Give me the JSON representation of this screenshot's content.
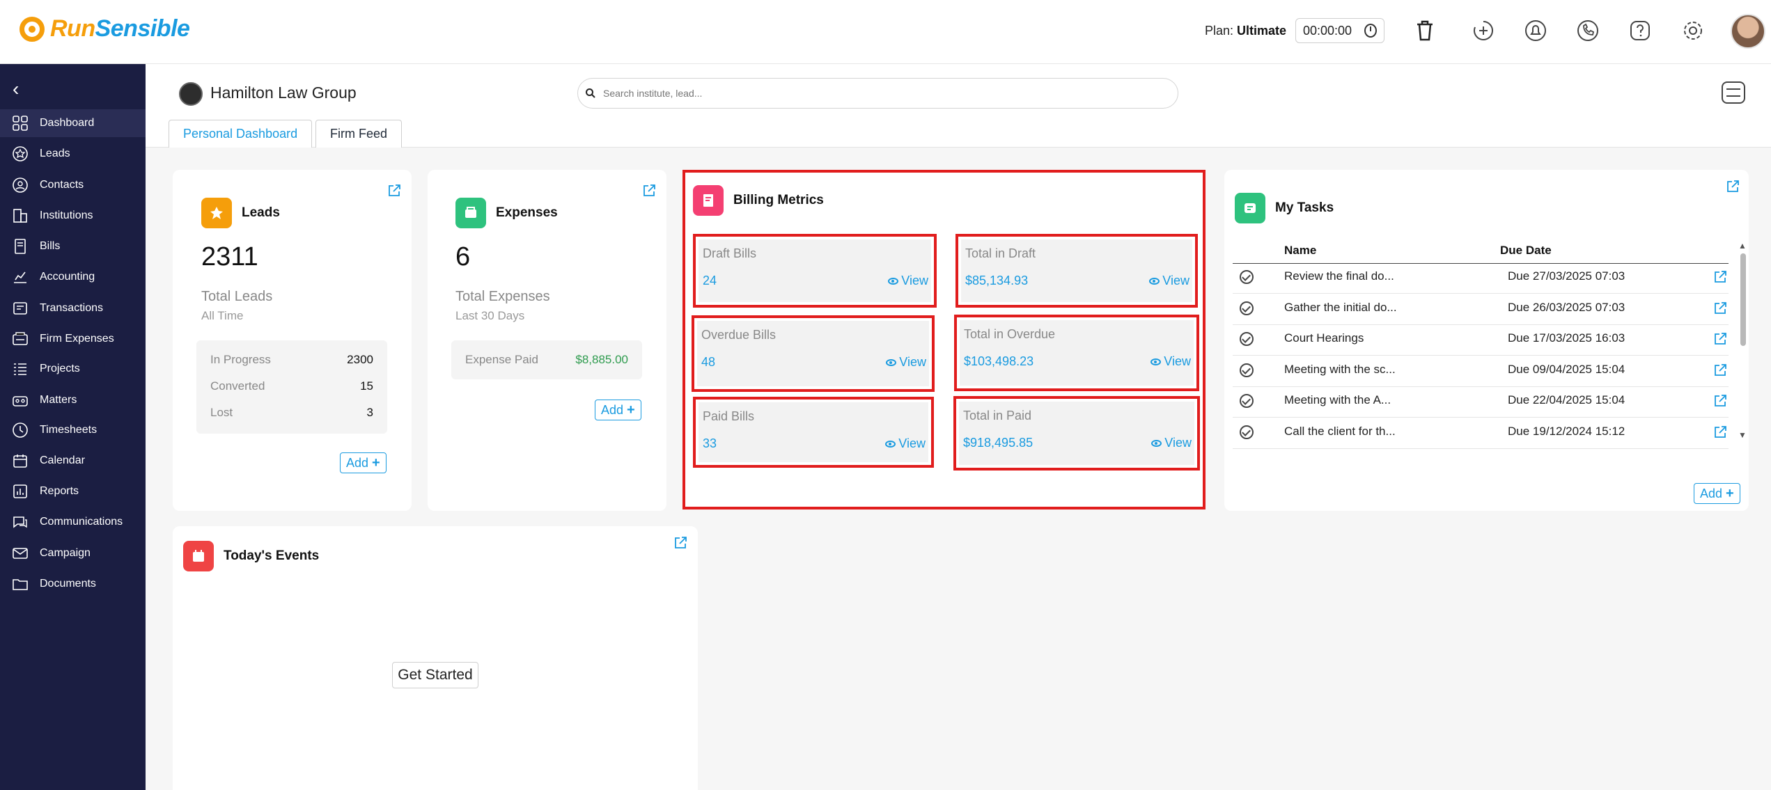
{
  "brand": {
    "name_part1": "Run",
    "name_part2": "Sensible",
    "color_orange": "#f59e0b",
    "color_blue": "#1a9be0"
  },
  "topbar": {
    "plan_label": "Plan:",
    "plan_value": "Ultimate",
    "timer": "00:00:00",
    "icons": [
      "trash-icon",
      "add-activity-icon",
      "bell-icon",
      "phone-icon",
      "help-icon",
      "gear-icon"
    ]
  },
  "sidebar": {
    "items": [
      {
        "label": "Dashboard",
        "icon": "dashboard-icon"
      },
      {
        "label": "Leads",
        "icon": "star-icon"
      },
      {
        "label": "Contacts",
        "icon": "contact-icon"
      },
      {
        "label": "Institutions",
        "icon": "building-icon"
      },
      {
        "label": "Bills",
        "icon": "bill-icon"
      },
      {
        "label": "Accounting",
        "icon": "ledger-icon"
      },
      {
        "label": "Transactions",
        "icon": "transactions-icon"
      },
      {
        "label": "Firm Expenses",
        "icon": "expenses-icon"
      },
      {
        "label": "Projects",
        "icon": "projects-icon"
      },
      {
        "label": "Matters",
        "icon": "matters-icon"
      },
      {
        "label": "Timesheets",
        "icon": "clock-icon"
      },
      {
        "label": "Calendar",
        "icon": "calendar-icon"
      },
      {
        "label": "Reports",
        "icon": "reports-icon"
      },
      {
        "label": "Communications",
        "icon": "chat-icon"
      },
      {
        "label": "Campaign",
        "icon": "mail-icon"
      },
      {
        "label": "Documents",
        "icon": "folder-icon"
      }
    ]
  },
  "header": {
    "firm_name": "Hamilton Law Group",
    "search_placeholder": "Search institute, lead...",
    "tabs": [
      "Personal Dashboard",
      "Firm Feed"
    ]
  },
  "leads_card": {
    "title": "Leads",
    "total": "2311",
    "subtitle": "Total Leads",
    "period": "All Time",
    "stats": [
      {
        "label": "In Progress",
        "value": "2300"
      },
      {
        "label": "Converted",
        "value": "15"
      },
      {
        "label": "Lost",
        "value": "3"
      }
    ],
    "add_label": "Add"
  },
  "expenses_card": {
    "title": "Expenses",
    "total": "6",
    "subtitle": "Total Expenses",
    "period": "Last 30 Days",
    "paid_label": "Expense Paid",
    "paid_value": "$8,885.00",
    "add_label": "Add"
  },
  "billing_card": {
    "title": "Billing Metrics",
    "view_label": "View",
    "metrics": [
      {
        "label": "Draft Bills",
        "value": "24"
      },
      {
        "label": "Total in Draft",
        "value": "$85,134.93"
      },
      {
        "label": "Overdue Bills",
        "value": "48"
      },
      {
        "label": "Total in Overdue",
        "value": "$103,498.23"
      },
      {
        "label": "Paid Bills",
        "value": "33"
      },
      {
        "label": "Total in Paid",
        "value": "$918,495.85"
      }
    ]
  },
  "tasks_card": {
    "title": "My Tasks",
    "col_name": "Name",
    "col_due": "Due Date",
    "rows": [
      {
        "name": "Review the final do...",
        "due": "Due 27/03/2025 07:03"
      },
      {
        "name": "Gather the initial do...",
        "due": "Due 26/03/2025 07:03"
      },
      {
        "name": "Court Hearings",
        "due": "Due 17/03/2025 16:03"
      },
      {
        "name": "Meeting with the sc...",
        "due": "Due 09/04/2025 15:04"
      },
      {
        "name": "Meeting with the A...",
        "due": "Due 22/04/2025 15:04"
      },
      {
        "name": "Call the client for th...",
        "due": "Due 19/12/2024 15:12"
      }
    ],
    "add_label": "Add"
  },
  "events_card": {
    "title": "Today's Events",
    "cta": "Get Started"
  }
}
